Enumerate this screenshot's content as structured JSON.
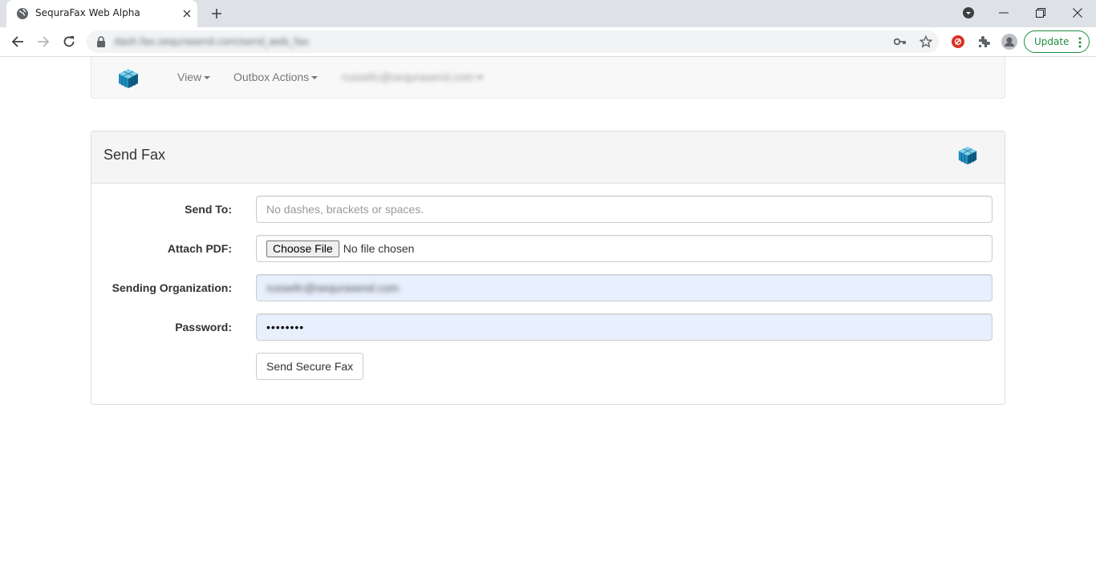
{
  "browser": {
    "tab_title": "SequraFax Web Alpha",
    "url": "dash.fax.sequrasend.com/send_web_fax",
    "update_label": "Update",
    "colors": {
      "tabstrip": "#dee1e6",
      "update_accent": "#1e8e3e"
    },
    "icons": [
      "globe-icon",
      "close-icon",
      "plus-icon",
      "back-icon",
      "forward-icon",
      "reload-icon",
      "lock-icon",
      "key-icon",
      "star-icon",
      "extension-badge-icon",
      "puzzle-icon",
      "profile-icon",
      "kebab-menu-icon",
      "minimize-icon",
      "restore-icon",
      "window-close-icon",
      "tab-search-icon"
    ]
  },
  "navbar": {
    "items": [
      {
        "label": "View"
      },
      {
        "label": "Outbox Actions"
      },
      {
        "label": "russellc@sequrasend.com"
      }
    ]
  },
  "panel": {
    "title": "Send Fax"
  },
  "form": {
    "send_to": {
      "label": "Send To:",
      "placeholder": "No dashes, brackets or spaces.",
      "value": ""
    },
    "attach_pdf": {
      "label": "Attach PDF:",
      "button": "Choose File",
      "status": "No file chosen"
    },
    "sending_org": {
      "label": "Sending Organization:",
      "value": "russellc@sequrasend.com"
    },
    "password": {
      "label": "Password:",
      "value": "••••••••"
    },
    "submit_label": "Send Secure Fax"
  }
}
